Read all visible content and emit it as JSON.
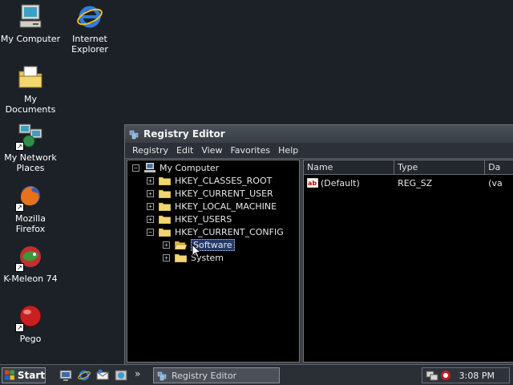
{
  "desktop": {
    "icons": [
      {
        "label": "My Computer"
      },
      {
        "label": "Internet Explorer"
      },
      {
        "label": "My Documents"
      },
      {
        "label": "My Network Places"
      },
      {
        "label": "Mozilla Firefox"
      },
      {
        "label": "K-Meleon 74"
      },
      {
        "label": "Pego"
      }
    ]
  },
  "window": {
    "title": "Registry Editor",
    "menu": [
      "Registry",
      "Edit",
      "View",
      "Favorites",
      "Help"
    ],
    "tree": {
      "root": "My Computer",
      "keys": [
        "HKEY_CLASSES_ROOT",
        "HKEY_CURRENT_USER",
        "HKEY_LOCAL_MACHINE",
        "HKEY_USERS",
        "HKEY_CURRENT_CONFIG"
      ],
      "expanded_children": [
        "Software",
        "System"
      ],
      "selected": "Software"
    },
    "list": {
      "columns": [
        "Name",
        "Type",
        "Da"
      ],
      "rows": [
        {
          "name": "(Default)",
          "type": "REG_SZ",
          "data": "(va"
        }
      ]
    }
  },
  "taskbar": {
    "start_label": "Start",
    "task_label": "Registry Editor",
    "clock": "3:08 PM",
    "more_label": "»"
  },
  "colors": {
    "desktop": "#1c2128",
    "selection": "#243a6a"
  }
}
